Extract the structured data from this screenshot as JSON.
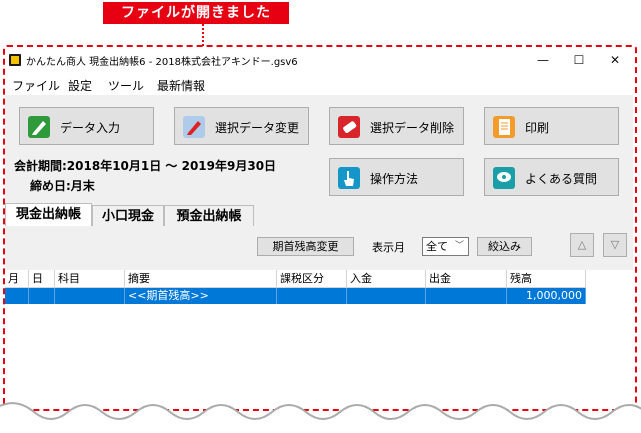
{
  "callout": "ファイルが開きました",
  "window": {
    "title": "かんたん商人 現金出納帳6 - 2018株式会社アキンドー.gsv6",
    "controls": {
      "minimize": "—",
      "maximize": "☐",
      "close": "✕"
    }
  },
  "menu": [
    "ファイル",
    "設定",
    "ツール",
    "最新情報"
  ],
  "buttons": {
    "data_entry": "データ入力",
    "change_selected": "選択データ変更",
    "delete_selected": "選択データ削除",
    "print": "印刷",
    "how_to": "操作方法",
    "faq": "よくある質問"
  },
  "period": "会計期間:2018年10月1日 ～ 2019年9月30日",
  "deadline": "締め日:月末",
  "tabs": [
    "現金出納帳",
    "小口現金",
    "預金出納帳"
  ],
  "toolbar": {
    "opening_balance_button": "期首残高変更",
    "display_month_label": "表示月",
    "display_month_value": "全て",
    "filter_button": "絞込み",
    "up": "△",
    "down": "▽"
  },
  "grid": {
    "columns": [
      "月",
      "日",
      "科目",
      "摘要",
      "課税区分",
      "入金",
      "出金",
      "残高"
    ],
    "rows": [
      {
        "month": "",
        "day": "",
        "account": "",
        "description": "<<期首残高>>",
        "tax": "",
        "deposit": "",
        "withdrawal": "",
        "balance": "1,000,000"
      }
    ]
  },
  "colors": {
    "callout": "#e60012",
    "selection": "#0078d7"
  }
}
